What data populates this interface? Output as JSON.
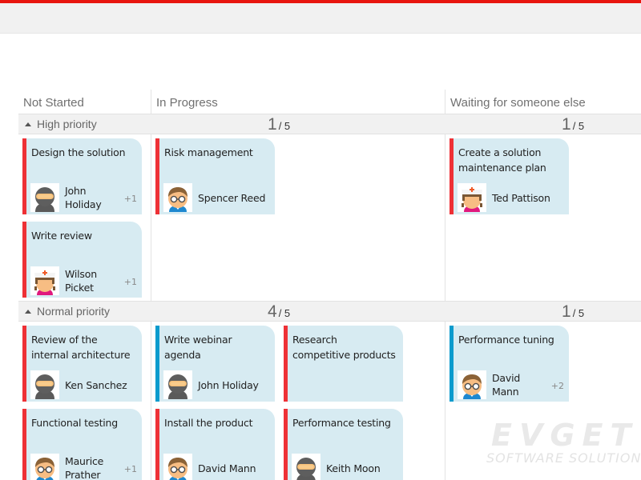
{
  "theme": {
    "accent": "#e8160f",
    "card_bg": "#d7ebf2",
    "priority_high": "#ee3136",
    "priority_normal": "#0b9bcd"
  },
  "columns": [
    {
      "label": "Not Started"
    },
    {
      "label": "In Progress"
    },
    {
      "label": "Waiting for someone else"
    }
  ],
  "swimlanes": [
    {
      "label": "High priority",
      "counts": [
        {
          "column": "In Progress",
          "current": "1",
          "limit": "/ 5"
        },
        {
          "column": "Waiting for someone else",
          "current": "1",
          "limit": "/ 5"
        }
      ],
      "cards": [
        {
          "title": "Design the solution",
          "assignee": "John Holiday",
          "extra": "+1",
          "avatar": "ninja-avatar",
          "column": "Not Started",
          "stripe": "red"
        },
        {
          "title": "Write review",
          "assignee": "Wilson Picket",
          "extra": "+1",
          "avatar": "nurse-avatar",
          "column": "Not Started",
          "stripe": "red"
        },
        {
          "title": "Risk management",
          "assignee": "Spencer Reed",
          "extra": "",
          "avatar": "glasses-boy-avatar",
          "column": "In Progress",
          "stripe": "red"
        },
        {
          "title": "Create a solution maintenance plan",
          "assignee": "Ted Pattison",
          "extra": "",
          "avatar": "nurse-avatar",
          "column": "Waiting for someone else",
          "stripe": "red"
        }
      ]
    },
    {
      "label": "Normal priority",
      "counts": [
        {
          "column": "In Progress",
          "current": "4",
          "limit": "/ 5"
        },
        {
          "column": "Waiting for someone else",
          "current": "1",
          "limit": "/ 5"
        }
      ],
      "cards": [
        {
          "title": "Review of the internal architecture",
          "assignee": "Ken Sanchez",
          "extra": "",
          "avatar": "ninja-avatar",
          "column": "Not Started",
          "stripe": "red"
        },
        {
          "title": "Functional testing",
          "assignee": "Maurice Prather",
          "extra": "+1",
          "avatar": "glasses-boy-avatar",
          "column": "Not Started",
          "stripe": "red"
        },
        {
          "title": "Write webinar agenda",
          "assignee": "John Holiday",
          "extra": "",
          "avatar": "ninja-avatar",
          "column": "In Progress",
          "stripe": "blue"
        },
        {
          "title": "Research competitive products",
          "assignee": "",
          "extra": "",
          "avatar": "",
          "column": "In Progress",
          "stripe": "red"
        },
        {
          "title": "Install the product",
          "assignee": "David Mann",
          "extra": "",
          "avatar": "glasses-boy-avatar",
          "column": "In Progress",
          "stripe": "red"
        },
        {
          "title": "Performance testing",
          "assignee": "Keith Moon",
          "extra": "",
          "avatar": "ninja-avatar",
          "column": "In Progress",
          "stripe": "red"
        },
        {
          "title": "Performance tuning",
          "assignee": "David Mann",
          "extra": "+2",
          "avatar": "glasses-boy-avatar",
          "column": "Waiting for someone else",
          "stripe": "blue"
        }
      ]
    }
  ],
  "watermark": {
    "brand": "EVGET",
    "tagline": "SOFTWARE SOLUTIONS"
  }
}
